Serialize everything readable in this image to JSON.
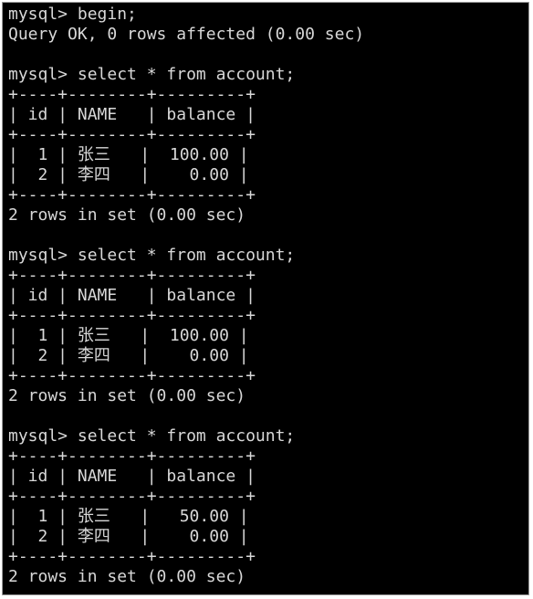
{
  "colors": {
    "background": "#000000",
    "text": "#d8d8d8",
    "frame": "#9a9a9a"
  },
  "terminal_lines": [
    "mysql> begin;",
    "Query OK, 0 rows affected (0.00 sec)",
    "",
    "mysql> select * from account;",
    "+----+--------+---------+",
    "| id | NAME   | balance |",
    "+----+--------+---------+",
    "|  1 | 张三   |  100.00 |",
    "|  2 | 李四   |    0.00 |",
    "+----+--------+---------+",
    "2 rows in set (0.00 sec)",
    "",
    "mysql> select * from account;",
    "+----+--------+---------+",
    "| id | NAME   | balance |",
    "+----+--------+---------+",
    "|  1 | 张三   |  100.00 |",
    "|  2 | 李四   |    0.00 |",
    "+----+--------+---------+",
    "2 rows in set (0.00 sec)",
    "",
    "mysql> select * from account;",
    "+----+--------+---------+",
    "| id | NAME   | balance |",
    "+----+--------+---------+",
    "|  1 | 张三   |   50.00 |",
    "|  2 | 李四   |    0.00 |",
    "+----+--------+---------+",
    "2 rows in set (0.00 sec)"
  ]
}
